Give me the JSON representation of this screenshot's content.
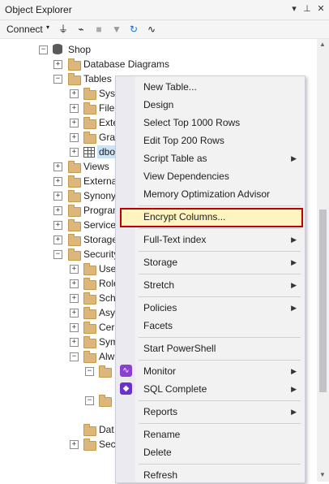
{
  "panel": {
    "title": "Object Explorer",
    "pin": "▾",
    "autohide": "⊥",
    "close": "✕"
  },
  "toolbar": {
    "connect_label": "Connect",
    "caret": "▾"
  },
  "tree": {
    "database": "Shop",
    "database_diagrams": "Database Diagrams",
    "tables": "Tables",
    "system_tables": "Syst",
    "file_tables": "File",
    "external_tables": "Exte",
    "graph_tables": "Gra",
    "selected_table": "dbo",
    "views": "Views",
    "external": "Externa",
    "synonyms": "Synony",
    "programmability": "Progran",
    "service": "Service",
    "storage": "Storage",
    "security": "Security",
    "users": "Use",
    "roles": "Role",
    "schemas": "Sch",
    "asymmetric": "Asy",
    "certificates": "Cer",
    "symmetric": "Sym",
    "always_encrypted": "Alw",
    "database_audit": "Dat",
    "security_policies": "Sec"
  },
  "menu": {
    "new_table": "New Table...",
    "design": "Design",
    "select_top": "Select Top 1000 Rows",
    "edit_top": "Edit Top 200 Rows",
    "script_table": "Script Table as",
    "view_dependencies": "View Dependencies",
    "memory_optimization": "Memory Optimization Advisor",
    "encrypt_columns": "Encrypt Columns...",
    "full_text": "Full-Text index",
    "storage": "Storage",
    "stretch": "Stretch",
    "policies": "Policies",
    "facets": "Facets",
    "powershell": "Start PowerShell",
    "monitor": "Monitor",
    "sql_complete": "SQL Complete",
    "reports": "Reports",
    "rename": "Rename",
    "delete": "Delete",
    "refresh": "Refresh",
    "submenu_arrow": "▶"
  },
  "colors": {
    "highlight_border": "#c00000",
    "highlight_fill": "#fdf4bf",
    "monitor_icon": "#8b3fd0",
    "sqlcomplete_icon": "#6a2fd0"
  }
}
